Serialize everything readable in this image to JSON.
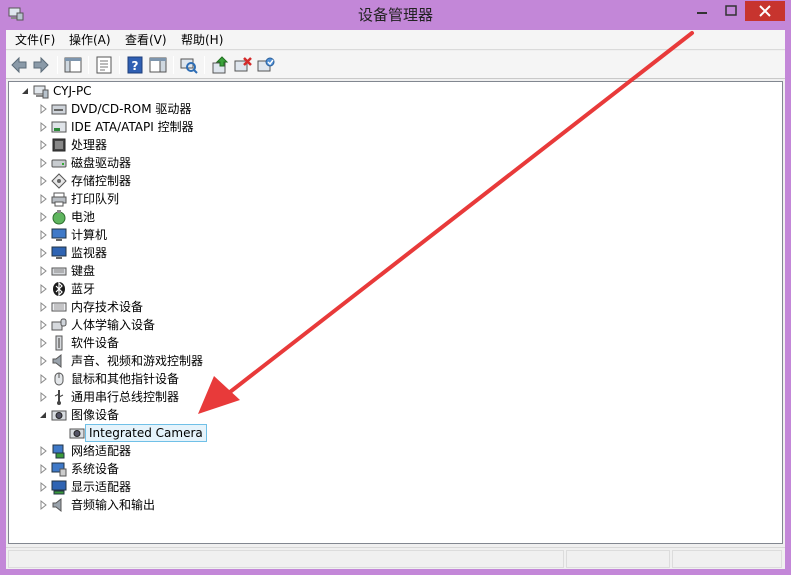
{
  "window": {
    "title": "设备管理器",
    "accent": "#c387d8",
    "icon": "device-manager-icon",
    "controls": [
      "minimize",
      "maximize",
      "close"
    ]
  },
  "menu": {
    "items": [
      {
        "label": "文件(F)"
      },
      {
        "label": "操作(A)"
      },
      {
        "label": "查看(V)"
      },
      {
        "label": "帮助(H)"
      }
    ]
  },
  "toolbar": {
    "buttons": [
      "back",
      "forward",
      "console-tree",
      "properties",
      "help",
      "action-pane",
      "scan-hardware",
      "update-driver",
      "uninstall",
      "enable"
    ]
  },
  "tree": {
    "root": {
      "label": "CYJ-PC",
      "icon": "computer-icon",
      "expanded": true
    },
    "categories": [
      {
        "label": "DVD/CD-ROM 驱动器",
        "icon": "dvd-drive-icon",
        "expanded": false
      },
      {
        "label": "IDE ATA/ATAPI 控制器",
        "icon": "ide-controller-icon",
        "expanded": false
      },
      {
        "label": "处理器",
        "icon": "processor-icon",
        "expanded": false
      },
      {
        "label": "磁盘驱动器",
        "icon": "disk-drive-icon",
        "expanded": false
      },
      {
        "label": "存储控制器",
        "icon": "storage-controller-icon",
        "expanded": false
      },
      {
        "label": "打印队列",
        "icon": "printer-icon",
        "expanded": false
      },
      {
        "label": "电池",
        "icon": "battery-icon",
        "expanded": false
      },
      {
        "label": "计算机",
        "icon": "computer-monitor-icon",
        "expanded": false
      },
      {
        "label": "监视器",
        "icon": "monitor-icon",
        "expanded": false
      },
      {
        "label": "键盘",
        "icon": "keyboard-icon",
        "expanded": false
      },
      {
        "label": "蓝牙",
        "icon": "bluetooth-icon",
        "expanded": false
      },
      {
        "label": "内存技术设备",
        "icon": "memory-device-icon",
        "expanded": false
      },
      {
        "label": "人体学输入设备",
        "icon": "hid-icon",
        "expanded": false
      },
      {
        "label": "软件设备",
        "icon": "software-device-icon",
        "expanded": false
      },
      {
        "label": "声音、视频和游戏控制器",
        "icon": "speaker-icon",
        "expanded": false
      },
      {
        "label": "鼠标和其他指针设备",
        "icon": "mouse-icon",
        "expanded": false
      },
      {
        "label": "通用串行总线控制器",
        "icon": "usb-icon",
        "expanded": false
      },
      {
        "label": "图像设备",
        "icon": "camera-icon",
        "expanded": true,
        "children": [
          {
            "label": "Integrated Camera",
            "icon": "webcam-icon",
            "selected": true
          }
        ]
      },
      {
        "label": "网络适配器",
        "icon": "network-adapter-icon",
        "expanded": false
      },
      {
        "label": "系统设备",
        "icon": "system-device-icon",
        "expanded": false
      },
      {
        "label": "显示适配器",
        "icon": "display-adapter-icon",
        "expanded": false
      },
      {
        "label": "音频输入和输出",
        "icon": "audio-io-icon",
        "expanded": false
      }
    ]
  },
  "annotation": {
    "type": "arrow",
    "color": "#e83a3a"
  }
}
